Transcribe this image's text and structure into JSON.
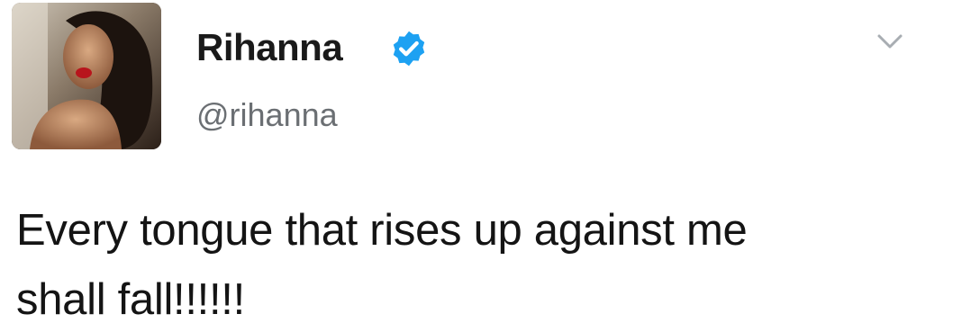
{
  "tweet": {
    "author": {
      "display_name": "Rihanna",
      "handle": "@rihanna",
      "verified": true,
      "avatar_icon": "profile-photo"
    },
    "text_lines": [
      "Every tongue that rises up against me",
      "shall fall!!!!!!"
    ],
    "menu_icon": "chevron-down-icon"
  },
  "colors": {
    "verified_badge": "#1da1f2",
    "name": "#1a1a1a",
    "handle": "#6b6f73",
    "chevron": "#a8adb2",
    "text": "#141414"
  }
}
